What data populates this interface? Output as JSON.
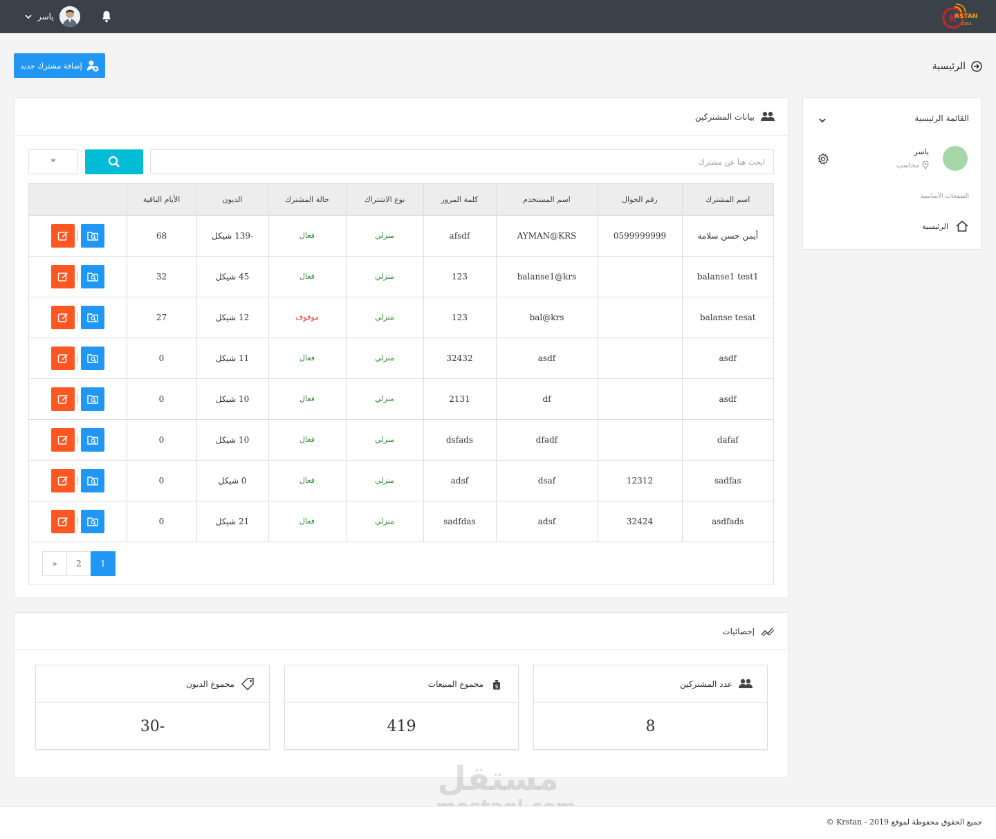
{
  "topbar": {
    "user_name": "ياسر",
    "logo_text": "KRSTAN",
    "logo_sub": "Data"
  },
  "header": {
    "add_button": "إضافة مشترك جديد",
    "breadcrumb": "الرئيسية"
  },
  "subscribers": {
    "title": "بيانات المشتركين",
    "search_placeholder": "ابحث هنا عن مشترك",
    "star_value": "*",
    "columns": [
      "اسم المشترك",
      "رقم الجوال",
      "اسم المستخدم",
      "كلمة المرور",
      "نوع الاشتراك",
      "حالة المشترك",
      "الديون",
      "الأيام الباقية",
      ""
    ],
    "rows": [
      {
        "name": "أيمن حسن سلامة",
        "phone": "0599999999",
        "username": "AYMAN@KRS",
        "password": "afsdf",
        "type": "منزلي",
        "status": "فعال",
        "status_kind": "active",
        "debt": "-139 شيكل",
        "days": "68"
      },
      {
        "name": "balanse1 test1",
        "phone": "",
        "username": "balanse1@krs",
        "password": "123",
        "type": "منزلي",
        "status": "فعال",
        "status_kind": "active",
        "debt": "45 شيكل",
        "days": "32"
      },
      {
        "name": "balanse tesat",
        "phone": "",
        "username": "bal@krs",
        "password": "123",
        "type": "منزلي",
        "status": "موقوف",
        "status_kind": "stopped",
        "debt": "12 شيكل",
        "days": "27"
      },
      {
        "name": "asdf",
        "phone": "",
        "username": "asdf",
        "password": "32432",
        "type": "منزلي",
        "status": "فعال",
        "status_kind": "active",
        "debt": "11 شيكل",
        "days": "0"
      },
      {
        "name": "asdf",
        "phone": "",
        "username": "df",
        "password": "2131",
        "type": "منزلي",
        "status": "فعال",
        "status_kind": "active",
        "debt": "10 شيكل",
        "days": "0"
      },
      {
        "name": "dafaf",
        "phone": "",
        "username": "dfadf",
        "password": "dsfads",
        "type": "منزلي",
        "status": "فعال",
        "status_kind": "active",
        "debt": "10 شيكل",
        "days": "0"
      },
      {
        "name": "sadfas",
        "phone": "12312",
        "username": "dsaf",
        "password": "adsf",
        "type": "منزلي",
        "status": "فعال",
        "status_kind": "active",
        "debt": "0 شيكل",
        "days": "0"
      },
      {
        "name": "asdfads",
        "phone": "32424",
        "username": "adsf",
        "password": "sadfdas",
        "type": "منزلي",
        "status": "فعال",
        "status_kind": "active",
        "debt": "21 شيكل",
        "days": "0"
      }
    ],
    "pagination": [
      "1",
      "2",
      "»"
    ],
    "current_page": "1"
  },
  "stats": {
    "title": "إحصائيات",
    "cards": [
      {
        "label": "عدد المشتركين",
        "value": "8",
        "icon": "users-icon"
      },
      {
        "label": "مجموع المبيعات",
        "value": "419",
        "icon": "money-bag-icon"
      },
      {
        "label": "مجموع الديون",
        "value": "-30",
        "icon": "tag-icon"
      }
    ]
  },
  "sidebar": {
    "menu_title": "القائمة الرئيسية",
    "user_name": "ياسر",
    "user_role": "محاسب",
    "avatar_text": "-",
    "section_label": "الصفحات الأساسية",
    "home_label": "الرئيسية"
  },
  "footer": {
    "text": "جميع الحقوق محفوظة لموقع 2019 - Krstan ©"
  },
  "watermark": {
    "arabic": "مستقل",
    "latin": "mostaql.com"
  },
  "colors": {
    "topbar": "#3a4149",
    "primary": "#2196f3",
    "search": "#00bcd4",
    "edit": "#ff5722",
    "active": "#2e8b2e",
    "stopped": "#e53935"
  }
}
